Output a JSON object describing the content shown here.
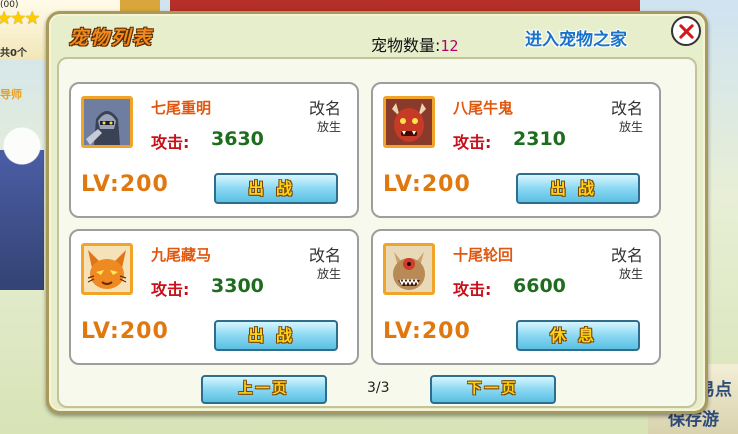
{
  "background": {
    "top_left_text": "(00)",
    "left_text_1": "共0个",
    "left_text_2": "导师",
    "right_text_1": "易点",
    "right_text_2": "保存游",
    "stars": "★★★"
  },
  "dialog": {
    "title": "宠物列表",
    "count_label": "宠物数量:",
    "count_value": "12",
    "enter_home": "进入宠物之家"
  },
  "pets": [
    {
      "name": "七尾重明",
      "attack_label": "攻击:",
      "attack": "3630",
      "level": "LV:200",
      "rename": "改名",
      "release": "放生",
      "action": "出战",
      "portrait_icon": "armored-knight"
    },
    {
      "name": "八尾牛鬼",
      "attack_label": "攻击:",
      "attack": "2310",
      "level": "LV:200",
      "rename": "改名",
      "release": "放生",
      "action": "出战",
      "portrait_icon": "red-ox-demon"
    },
    {
      "name": "九尾藏马",
      "attack_label": "攻击:",
      "attack": "3300",
      "level": "LV:200",
      "rename": "改名",
      "release": "放生",
      "action": "出战",
      "portrait_icon": "nine-tailed-fox"
    },
    {
      "name": "十尾轮回",
      "attack_label": "攻击:",
      "attack": "6600",
      "level": "LV:200",
      "rename": "改名",
      "release": "放生",
      "action": "休息",
      "portrait_icon": "ten-tails-beast"
    }
  ],
  "pager": {
    "prev": "上一页",
    "next": "下一页",
    "indicator": "3/3"
  },
  "colors": {
    "title_orange": "#f08a1d",
    "pet_name": "#e05810",
    "attack_label": "#c8101a",
    "attack_value": "#1e6d1e",
    "count_value": "#b3006b",
    "link_blue": "#1a73c9"
  }
}
